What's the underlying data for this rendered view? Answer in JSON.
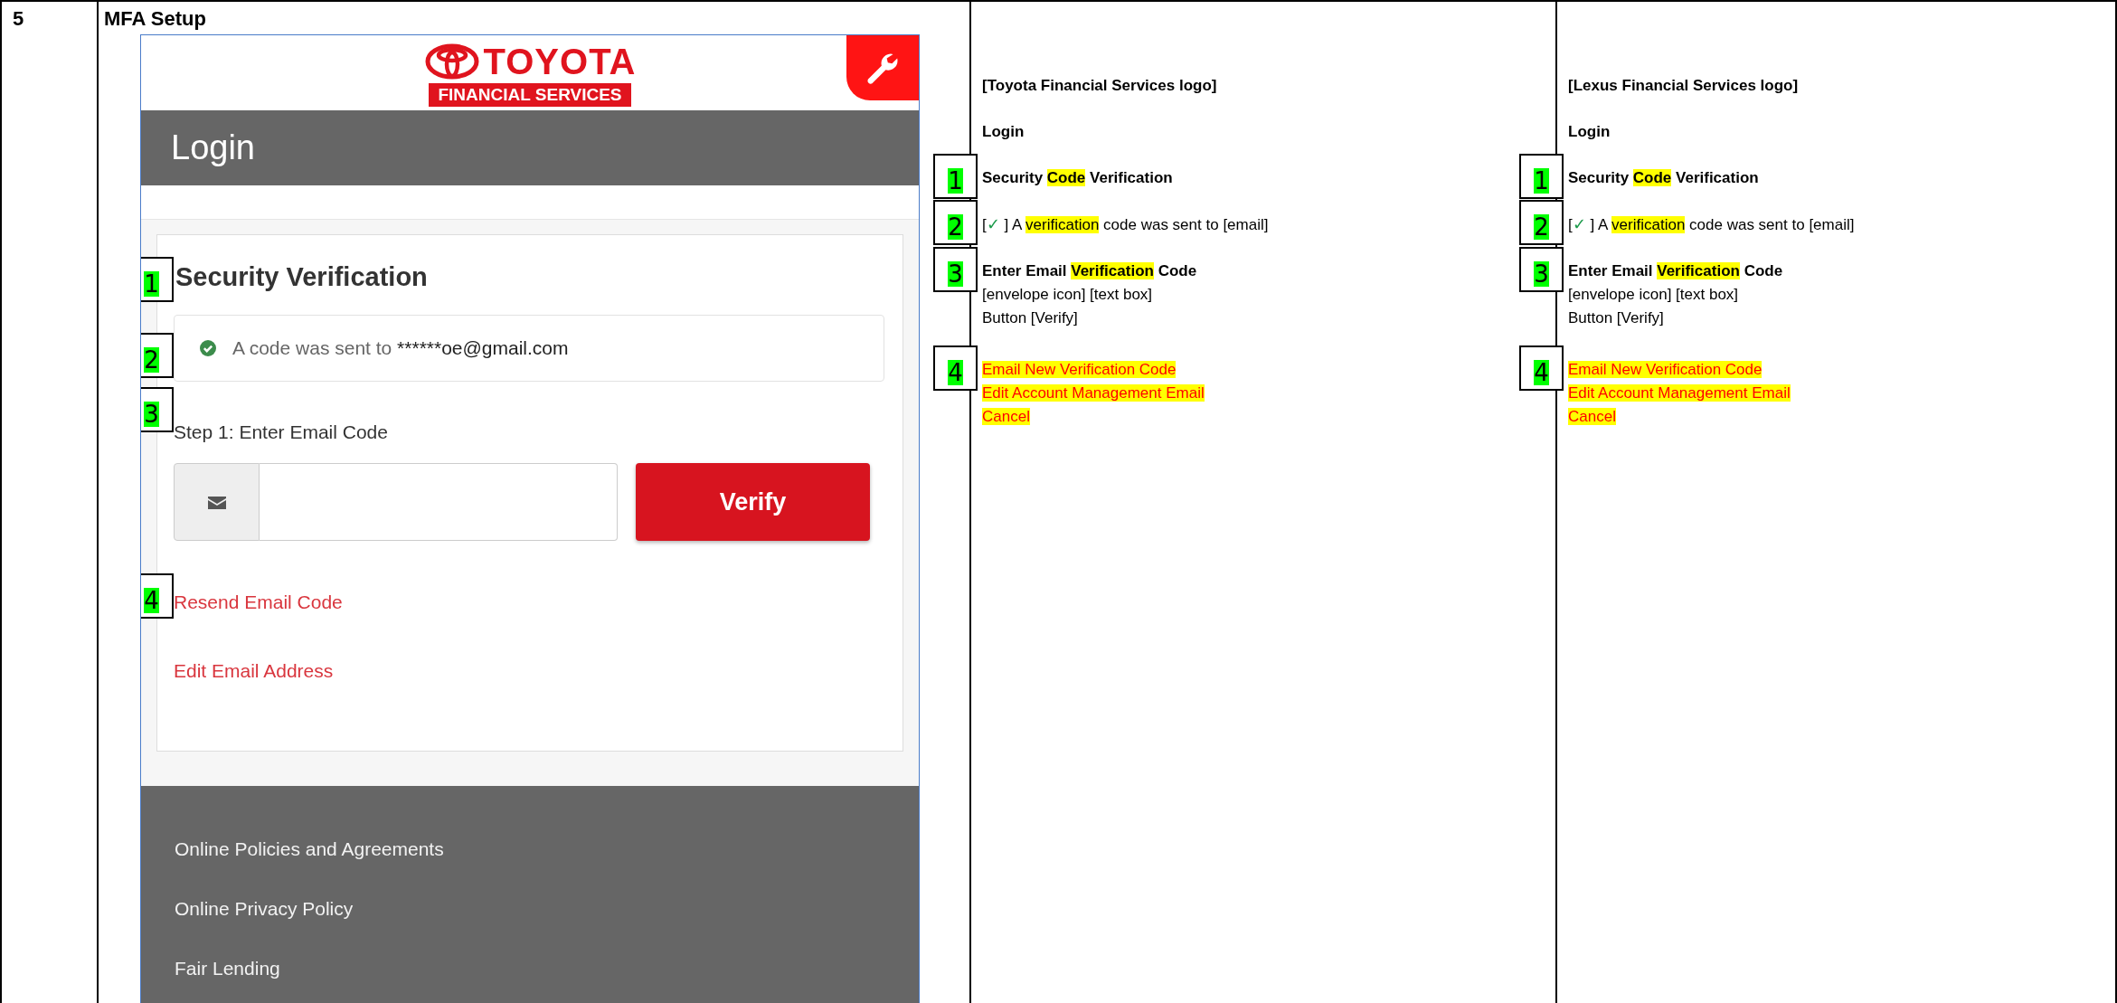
{
  "row": {
    "number": "5",
    "title": "MFA Setup"
  },
  "screenshot": {
    "logo": {
      "brand": "TOYOTA",
      "sub": "FINANCIAL SERVICES"
    },
    "page_title": "Login",
    "heading": {
      "text": "Security Verification",
      "callout": "1"
    },
    "alert": {
      "message": "A code was sent to ",
      "email": "******oe@gmail.com",
      "callout": "2"
    },
    "step": {
      "label": "Step 1: Enter Email Code",
      "callout": "3"
    },
    "button": "Verify",
    "links": [
      {
        "text": "Resend Email Code",
        "callout": "4"
      },
      {
        "text": "Edit Email Address"
      }
    ],
    "footer_links": [
      "Online Policies and Agreements",
      "Online Privacy Policy",
      "Fair Lending"
    ]
  },
  "spec_columns": [
    {
      "blocks": [
        {
          "lines": [
            {
              "kind": "heading",
              "segments": [
                {
                  "text": "[Toyota Financial Services logo]",
                  "highlight": false,
                  "kind": "text"
                }
              ]
            }
          ]
        },
        {
          "lines": [
            {
              "kind": "heading",
              "segments": [
                {
                  "text": "Login",
                  "highlight": false,
                  "kind": "text"
                }
              ]
            }
          ]
        },
        {
          "callout": "1",
          "lines": [
            {
              "kind": "heading",
              "segments": [
                {
                  "text": "Security ",
                  "highlight": false,
                  "kind": "text"
                },
                {
                  "text": "Code",
                  "highlight": true,
                  "kind": "text"
                },
                {
                  "text": " Verification",
                  "highlight": false,
                  "kind": "text"
                }
              ]
            }
          ]
        },
        {
          "callout": "2",
          "lines": [
            {
              "kind": "text",
              "segments": [
                {
                  "text": "[",
                  "highlight": false,
                  "kind": "text"
                },
                {
                  "text": "✓",
                  "highlight": false,
                  "kind": "check"
                },
                {
                  "text": " ] A ",
                  "highlight": false,
                  "kind": "text"
                },
                {
                  "text": "verification",
                  "highlight": true,
                  "kind": "text"
                },
                {
                  "text": " code was sent to [email]",
                  "highlight": false,
                  "kind": "text"
                }
              ]
            }
          ]
        },
        {
          "callout": "3",
          "lines": [
            {
              "kind": "heading",
              "segments": [
                {
                  "text": "Enter Email ",
                  "highlight": false,
                  "kind": "text"
                },
                {
                  "text": "Verification",
                  "highlight": true,
                  "kind": "text"
                },
                {
                  "text": " Code",
                  "highlight": false,
                  "kind": "text"
                }
              ]
            },
            {
              "kind": "text",
              "segments": [
                {
                  "text": "[envelope icon] [text box]",
                  "highlight": false,
                  "kind": "text"
                }
              ]
            },
            {
              "kind": "text",
              "segments": [
                {
                  "text": "Button [Verify]",
                  "highlight": false,
                  "kind": "text"
                }
              ]
            }
          ]
        },
        {
          "callout": "4",
          "lines": [
            {
              "kind": "action",
              "segments": [
                {
                  "text": "Email New Verification Code",
                  "highlight": true,
                  "kind": "text"
                }
              ]
            },
            {
              "kind": "action",
              "segments": [
                {
                  "text": "Edit Account Management Email",
                  "highlight": true,
                  "kind": "text"
                }
              ]
            },
            {
              "kind": "action",
              "segments": [
                {
                  "text": "Cancel",
                  "highlight": true,
                  "kind": "text"
                }
              ]
            }
          ]
        }
      ]
    },
    {
      "blocks": [
        {
          "lines": [
            {
              "kind": "heading",
              "segments": [
                {
                  "text": "[Lexus Financial Services logo]",
                  "highlight": false,
                  "kind": "text"
                }
              ]
            }
          ]
        },
        {
          "lines": [
            {
              "kind": "heading",
              "segments": [
                {
                  "text": "Login",
                  "highlight": false,
                  "kind": "text"
                }
              ]
            }
          ]
        },
        {
          "callout": "1",
          "lines": [
            {
              "kind": "heading",
              "segments": [
                {
                  "text": "Security ",
                  "highlight": false,
                  "kind": "text"
                },
                {
                  "text": "Code",
                  "highlight": true,
                  "kind": "text"
                },
                {
                  "text": " Verification",
                  "highlight": false,
                  "kind": "text"
                }
              ]
            }
          ]
        },
        {
          "callout": "2",
          "lines": [
            {
              "kind": "text",
              "segments": [
                {
                  "text": "[",
                  "highlight": false,
                  "kind": "text"
                },
                {
                  "text": "✓",
                  "highlight": false,
                  "kind": "check"
                },
                {
                  "text": " ] A ",
                  "highlight": false,
                  "kind": "text"
                },
                {
                  "text": "verification",
                  "highlight": true,
                  "kind": "text"
                },
                {
                  "text": " code was sent to [email]",
                  "highlight": false,
                  "kind": "text"
                }
              ]
            }
          ]
        },
        {
          "callout": "3",
          "lines": [
            {
              "kind": "heading",
              "segments": [
                {
                  "text": "Enter Email ",
                  "highlight": false,
                  "kind": "text"
                },
                {
                  "text": "Verification",
                  "highlight": true,
                  "kind": "text"
                },
                {
                  "text": " Code",
                  "highlight": false,
                  "kind": "text"
                }
              ]
            },
            {
              "kind": "text",
              "segments": [
                {
                  "text": "[envelope icon] [text box]",
                  "highlight": false,
                  "kind": "text"
                }
              ]
            },
            {
              "kind": "text",
              "segments": [
                {
                  "text": "Button [Verify]",
                  "highlight": false,
                  "kind": "text"
                }
              ]
            }
          ]
        },
        {
          "callout": "4",
          "lines": [
            {
              "kind": "action",
              "segments": [
                {
                  "text": "Email New Verification Code",
                  "highlight": true,
                  "kind": "text"
                }
              ]
            },
            {
              "kind": "action",
              "segments": [
                {
                  "text": "Edit Account Management Email",
                  "highlight": true,
                  "kind": "text"
                }
              ]
            },
            {
              "kind": "action",
              "segments": [
                {
                  "text": "Cancel",
                  "highlight": true,
                  "kind": "text"
                }
              ]
            }
          ]
        }
      ]
    }
  ]
}
